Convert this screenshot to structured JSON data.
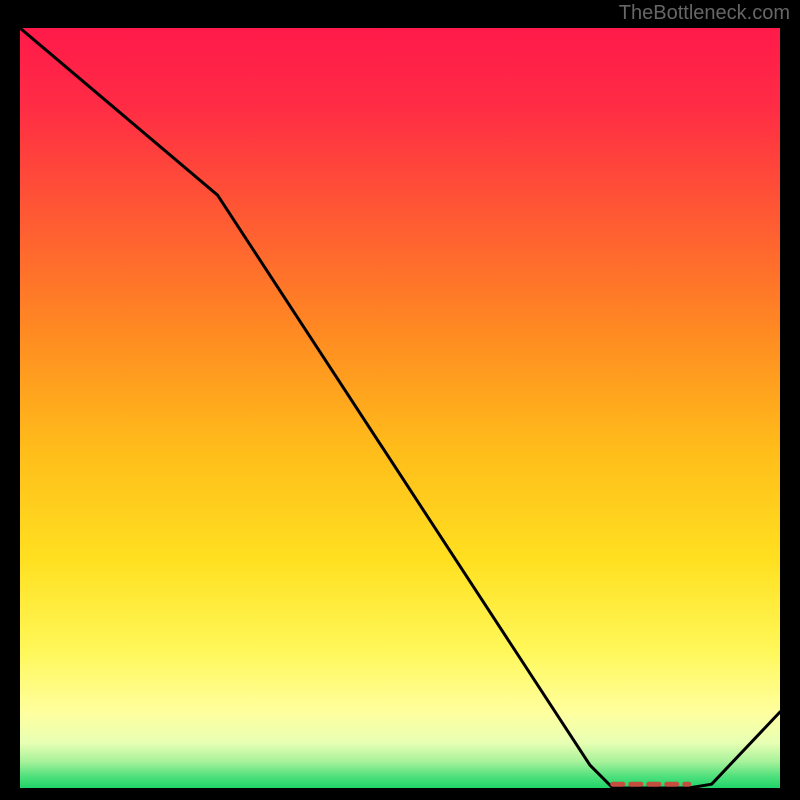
{
  "attribution": "TheBottleneck.com",
  "chart_data": {
    "type": "line",
    "title": "",
    "xlabel": "",
    "ylabel": "",
    "xlim": [
      0,
      100
    ],
    "ylim": [
      0,
      100
    ],
    "x": [
      0,
      26,
      75,
      78,
      88,
      91,
      100
    ],
    "values": [
      100,
      78,
      3,
      0,
      0,
      0.5,
      10
    ],
    "gradient_stops": [
      {
        "offset": 0.0,
        "color": "#ff1a4a"
      },
      {
        "offset": 0.1,
        "color": "#ff2b45"
      },
      {
        "offset": 0.25,
        "color": "#ff5a33"
      },
      {
        "offset": 0.4,
        "color": "#ff8a22"
      },
      {
        "offset": 0.55,
        "color": "#ffbb1a"
      },
      {
        "offset": 0.7,
        "color": "#ffe020"
      },
      {
        "offset": 0.82,
        "color": "#fff85a"
      },
      {
        "offset": 0.9,
        "color": "#ffff9e"
      },
      {
        "offset": 0.94,
        "color": "#e8ffb4"
      },
      {
        "offset": 0.965,
        "color": "#a8f29a"
      },
      {
        "offset": 0.985,
        "color": "#4de07c"
      },
      {
        "offset": 1.0,
        "color": "#20d468"
      }
    ],
    "markers": {
      "x_start": 78,
      "x_end": 88,
      "y": 0.5,
      "pattern": "dashed-segment",
      "color": "#c44f3f"
    }
  }
}
